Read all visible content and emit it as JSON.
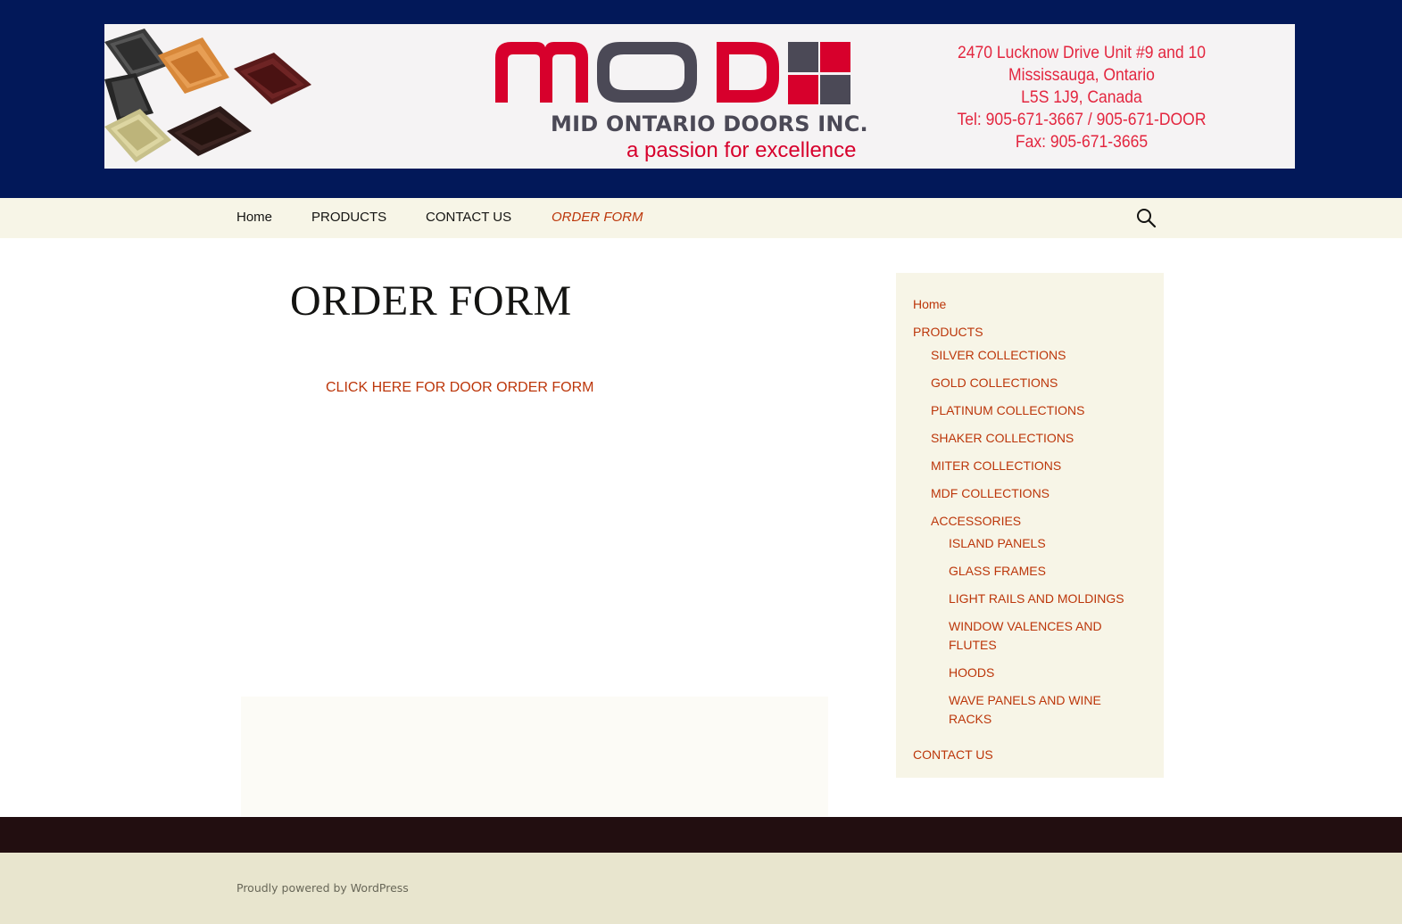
{
  "header": {
    "company_name": "MID ONTARIO DOORS INC.",
    "logo_text": "MOD",
    "tagline": "a passion for excellence",
    "address_lines": [
      "2470 Lucknow Drive Unit #9 and 10",
      "Mississauga, Ontario",
      "L5S 1J9, Canada",
      "Tel: 905-671-3667 / 905-671-DOOR",
      "Fax: 905-671-3665"
    ],
    "colors": {
      "header_bg": "#021859",
      "logo_red": "#d7002c",
      "logo_grey": "#4b4956"
    }
  },
  "nav": {
    "items": [
      {
        "label": "Home"
      },
      {
        "label": "PRODUCTS"
      },
      {
        "label": "CONTACT US"
      },
      {
        "label": "ORDER FORM",
        "current": true
      }
    ],
    "search_icon": "search-icon"
  },
  "main": {
    "title": "ORDER FORM",
    "order_link": "CLICK HERE FOR DOOR ORDER FORM"
  },
  "sidebar": {
    "items": [
      {
        "label": "Home",
        "level": 1
      },
      {
        "label": "PRODUCTS",
        "level": 1
      },
      {
        "label": "SILVER COLLECTIONS",
        "level": 2
      },
      {
        "label": "GOLD COLLECTIONS",
        "level": 2
      },
      {
        "label": "PLATINUM COLLECTIONS",
        "level": 2
      },
      {
        "label": "SHAKER COLLECTIONS",
        "level": 2
      },
      {
        "label": "MITER COLLECTIONS",
        "level": 2
      },
      {
        "label": "MDF COLLECTIONS",
        "level": 2
      },
      {
        "label": "ACCESSORIES",
        "level": 2
      },
      {
        "label": "ISLAND PANELS",
        "level": 3
      },
      {
        "label": "GLASS FRAMES",
        "level": 3
      },
      {
        "label": "LIGHT RAILS AND MOLDINGS",
        "level": 3
      },
      {
        "label": "WINDOW VALENCES AND",
        "level": 3
      },
      {
        "label": "FLUTES",
        "level": 3
      },
      {
        "label": "HOODS",
        "level": 3
      },
      {
        "label": "WAVE PANELS AND WINE",
        "level": 3
      },
      {
        "label": "RACKS",
        "level": 3
      },
      {
        "label": "CONTACT US",
        "level": 1
      }
    ]
  },
  "footer": {
    "powered_by": "Proudly powered by WordPress"
  },
  "colors": {
    "link": "#bc360a",
    "nav_bg": "#f7f5e7",
    "footer_strip": "#220e10",
    "footer_bg": "#e8e5ce"
  }
}
